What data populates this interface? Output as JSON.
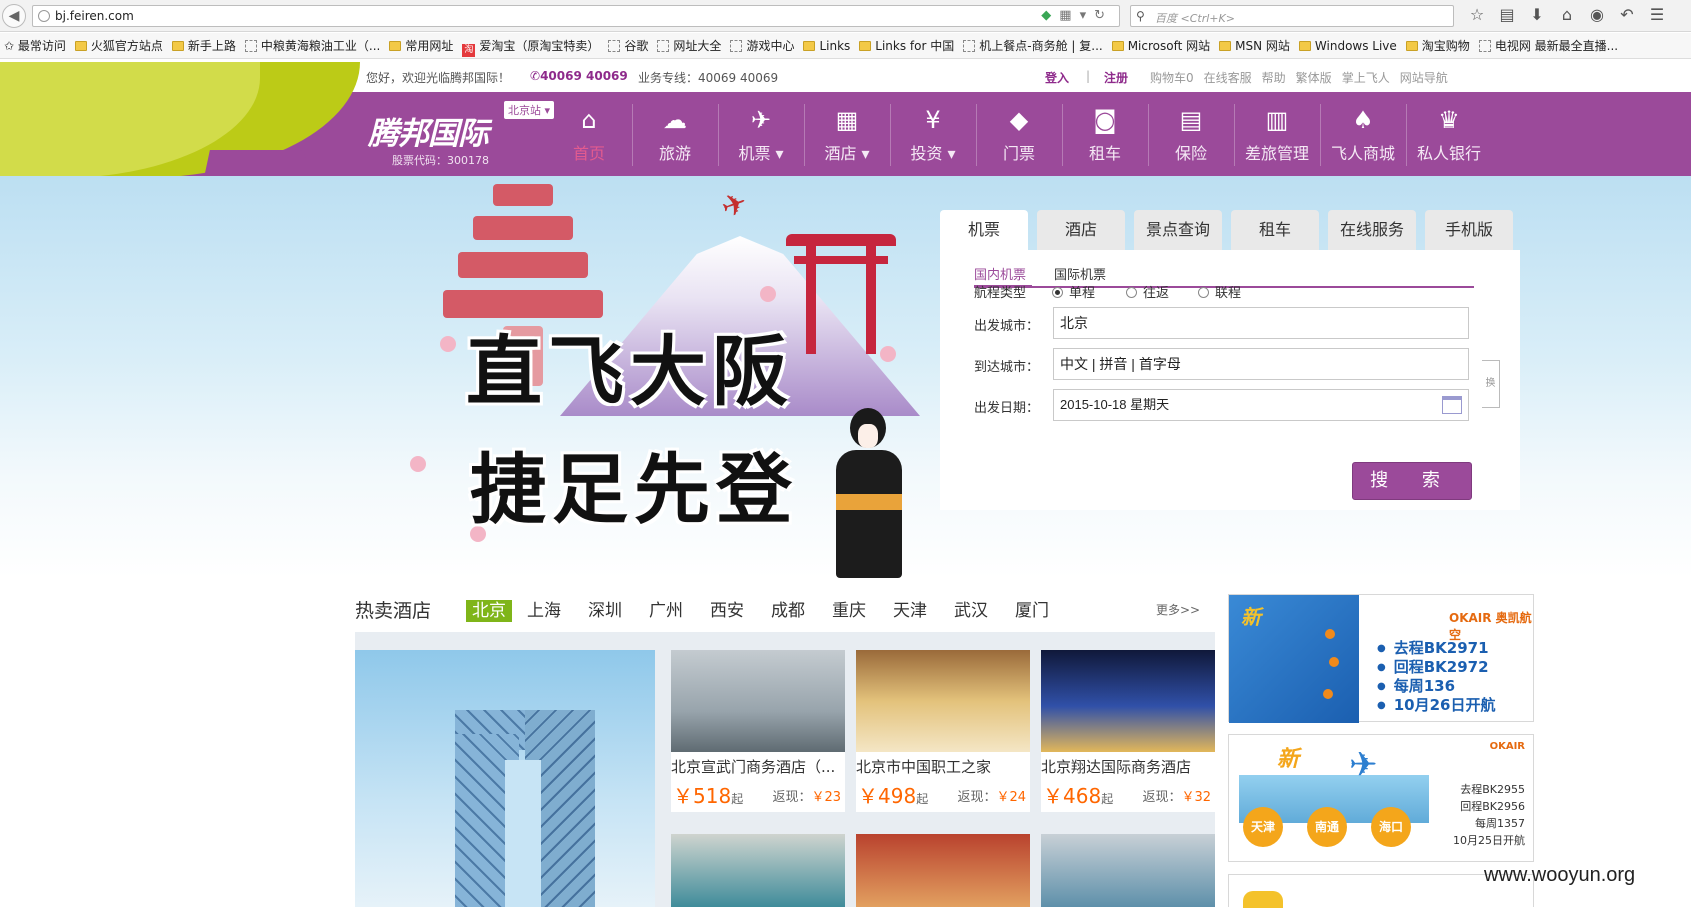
{
  "browser": {
    "url": "bj.feiren.com",
    "search_placeholder": "百度 <Ctrl+K>",
    "bookmarks": [
      "最常访问",
      "火狐官方站点",
      "新手上路",
      "中粮黄海粮油工业（...",
      "常用网址",
      "爱淘宝（原淘宝特卖）",
      "谷歌",
      "网址大全",
      "游戏中心",
      "Links",
      "Links for 中国",
      "机上餐点-商务舱 | 复...",
      "Microsoft 网站",
      "MSN 网站",
      "Windows Live",
      "淘宝购物",
      "电视网 最新最全直播..."
    ]
  },
  "topbar": {
    "welcome": "您好，欢迎光临腾邦国际！",
    "phone": "40069 40069",
    "business_line": "业务专线：40069 40069",
    "login": "登入",
    "sep": "|",
    "register": "注册",
    "links": [
      "购物车0",
      "在线客服",
      "帮助",
      "繁体版",
      "掌上飞人",
      "网站导航"
    ]
  },
  "header": {
    "logo": "腾邦国际",
    "stock_code": "股票代码：300178",
    "station": "北京站",
    "nav": [
      {
        "label": "首页",
        "icon": "home-icon",
        "glyph": "⌂"
      },
      {
        "label": "旅游",
        "icon": "travel-icon",
        "glyph": "☁"
      },
      {
        "label": "机票 ▾",
        "icon": "plane-icon",
        "glyph": "✈"
      },
      {
        "label": "酒店 ▾",
        "icon": "hotel-icon",
        "glyph": "▦"
      },
      {
        "label": "投资 ▾",
        "icon": "money-bag-icon",
        "glyph": "¥"
      },
      {
        "label": "门票",
        "icon": "ticket-icon",
        "glyph": "◆"
      },
      {
        "label": "租车",
        "icon": "car-icon",
        "glyph": "◙"
      },
      {
        "label": "保险",
        "icon": "document-icon",
        "glyph": "▤"
      },
      {
        "label": "差旅管理",
        "icon": "briefcase-icon",
        "glyph": "▥"
      },
      {
        "label": "飞人商城",
        "icon": "basket-icon",
        "glyph": "♠"
      },
      {
        "label": "私人银行",
        "icon": "person-icon",
        "glyph": "♛"
      }
    ]
  },
  "banner": {
    "line1": "直飞大阪",
    "line2": "捷足先登"
  },
  "search_panel": {
    "tabs": [
      "机票",
      "酒店",
      "景点查询",
      "租车",
      "在线服务",
      "手机版"
    ],
    "sub_tabs": [
      "国内机票",
      "国际机票"
    ],
    "trip_type_label": "航程类型",
    "trip_types": [
      "单程",
      "往返",
      "联程"
    ],
    "from_label": "出发城市：",
    "from_value": "北京",
    "to_label": "到达城市：",
    "to_placeholder": "中文 | 拼音 | 首字母",
    "date_label": "出发日期：",
    "date_value": "2015-10-18  星期天",
    "swap": "换",
    "search_button": "搜 索"
  },
  "hot_hotels": {
    "title": "热卖酒店",
    "cities": [
      "北京",
      "上海",
      "深圳",
      "广州",
      "西安",
      "成都",
      "重庆",
      "天津",
      "武汉",
      "厦门"
    ],
    "more": "更多>>",
    "cards": [
      {
        "name": "北京宣武门商务酒店（...",
        "price": "￥518",
        "suffix": "起",
        "rebate_label": "返现：",
        "rebate": "￥23"
      },
      {
        "name": "北京市中国职工之家",
        "price": "￥498",
        "suffix": "起",
        "rebate_label": "返现：",
        "rebate": "￥24"
      },
      {
        "name": "北京翔达国际商务酒店",
        "price": "￥468",
        "suffix": "起",
        "rebate_label": "返现：",
        "rebate": "￥32"
      }
    ]
  },
  "ads": {
    "ad1_xin": "新",
    "ad1_brand": "OKAIR 奥凯航空",
    "ad1_lines": [
      "去程BK2971",
      "回程BK2972",
      "每周136",
      "10月26日开航"
    ],
    "ad2_xin": "新",
    "ad2_cities": [
      "天津",
      "南通",
      "海口"
    ],
    "ad2_lines": [
      "去程BK2955",
      "回程BK2956",
      "每周1357",
      "10月25日开航"
    ]
  },
  "watermark": "www.wooyun.org"
}
